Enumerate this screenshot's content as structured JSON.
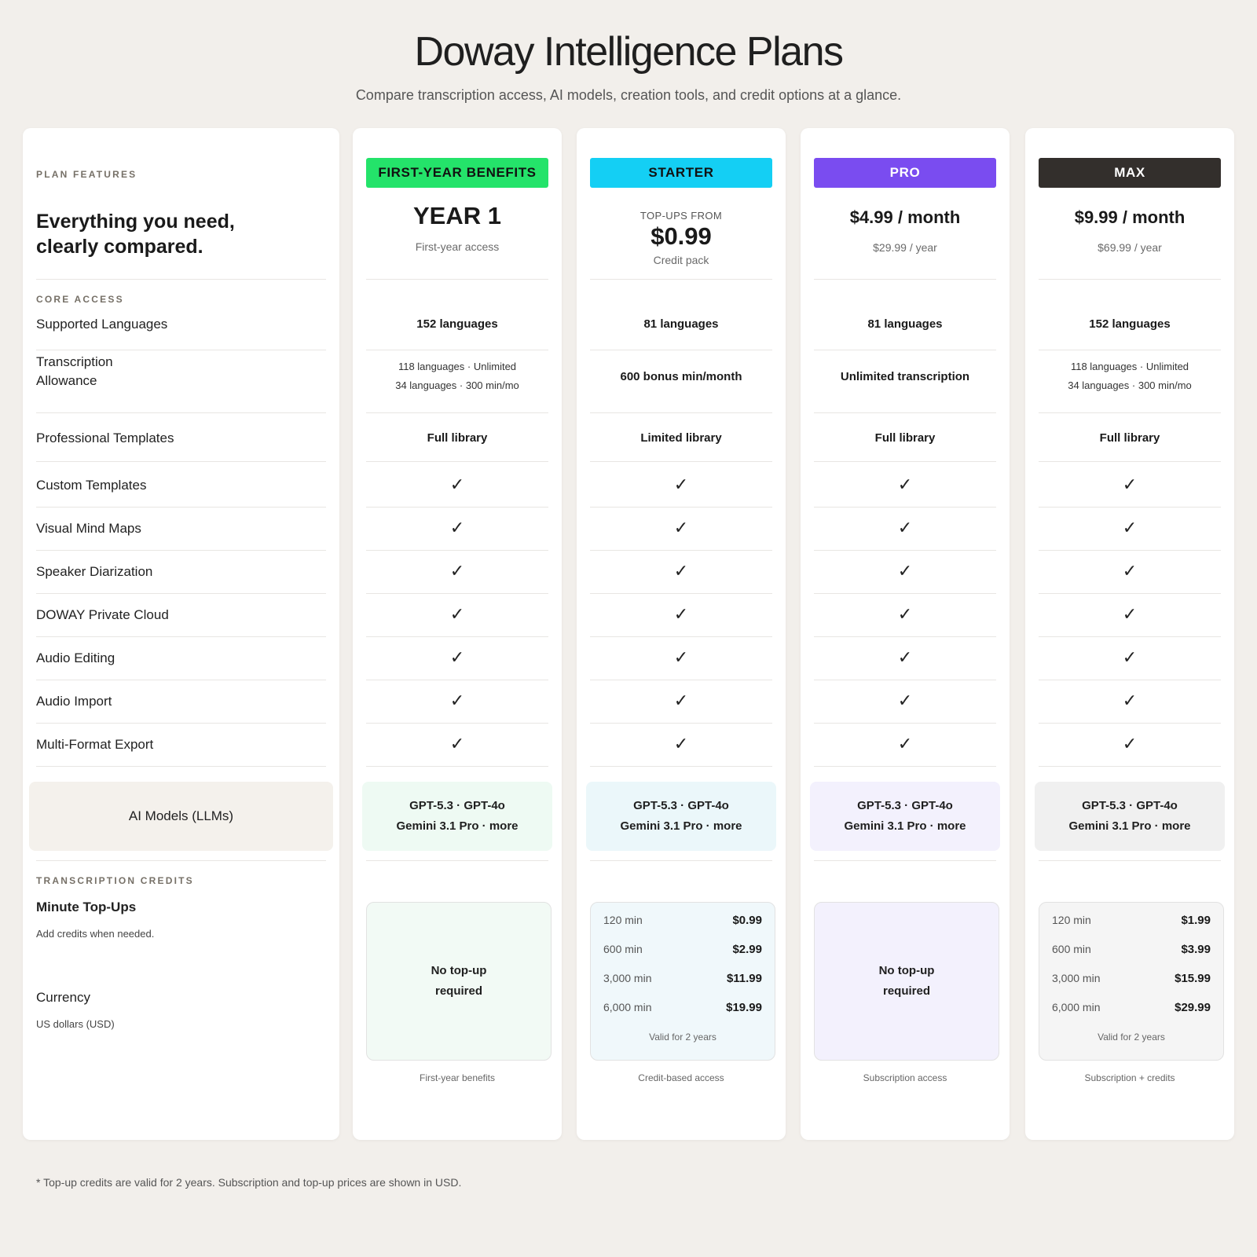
{
  "header": {
    "title": "Doway Intelligence Plans",
    "subtitle": "Compare transcription access, AI models, creation tools, and credit options at a glance."
  },
  "features": {
    "section_plan": "PLAN FEATURES",
    "headline_line1": "Everything you need,",
    "headline_line2": "clearly compared.",
    "section_core": "CORE ACCESS",
    "rows": [
      "Supported Languages",
      "Transcription",
      "Allowance",
      "Professional Templates",
      "Custom Templates",
      "Visual Mind Maps",
      "Speaker Diarization",
      "DOWAY Private Cloud",
      "Audio Editing",
      "Audio Import",
      "Multi-Format Export"
    ],
    "ai_models_label": "AI Models (LLMs)",
    "section_credits": "TRANSCRIPTION CREDITS",
    "topups_label": "Minute Top-Ups",
    "topups_note": "Add credits when needed.",
    "currency_label": "Currency",
    "currency_value": "US dollars (USD)"
  },
  "check_mark": "✓",
  "plans": [
    {
      "badge": "FIRST-YEAR BENEFITS",
      "badge_color": "#24e36a",
      "badge_text_color": "#111111",
      "headline": "YEAR 1",
      "headline_sub": "First-year access",
      "languages": "152 languages",
      "allowance_line1": "118 languages · Unlimited",
      "allowance_line2": "34 languages · 300 min/mo",
      "templates": "Full library",
      "ai_line1": "GPT-5.3 · GPT-4o",
      "ai_line2": "Gemini 3.1 Pro · more",
      "ai_bg": "#eefaf3",
      "credit_bg": "#f2faf5",
      "no_topup_line1": "No top-up",
      "no_topup_line2": "required",
      "footer": "First-year benefits"
    },
    {
      "badge": "STARTER",
      "badge_color": "#14cff4",
      "badge_text_color": "#111111",
      "price_label": "TOP-UPS FROM",
      "price": "$0.99",
      "price_sub": "Credit pack",
      "languages": "81 languages",
      "allowance": "600 bonus min/month",
      "templates": "Limited library",
      "ai_line1": "GPT-5.3 · GPT-4o",
      "ai_line2": "Gemini 3.1 Pro · more",
      "ai_bg": "#ebf7fa",
      "credit_bg": "#f0f8fb",
      "credits": [
        {
          "mins": "120 min",
          "price": "$0.99"
        },
        {
          "mins": "600 min",
          "price": "$2.99"
        },
        {
          "mins": "3,000 min",
          "price": "$11.99"
        },
        {
          "mins": "6,000 min",
          "price": "$19.99"
        }
      ],
      "valid": "Valid for 2 years",
      "footer": "Credit-based access"
    },
    {
      "badge": "PRO",
      "badge_color": "#7a4cf0",
      "badge_text_color": "#ffffff",
      "price": "$4.99 / month",
      "price_sub": "$29.99 / year",
      "languages": "81 languages",
      "allowance": "Unlimited transcription",
      "templates": "Full library",
      "ai_line1": "GPT-5.3 · GPT-4o",
      "ai_line2": "Gemini 3.1 Pro · more",
      "ai_bg": "#f3f1fd",
      "credit_bg": "#f3f1fd",
      "no_topup_line1": "No top-up",
      "no_topup_line2": "required",
      "footer": "Subscription access"
    },
    {
      "badge": "MAX",
      "badge_color": "#332f2c",
      "badge_text_color": "#ffffff",
      "price": "$9.99 / month",
      "price_sub": "$69.99 / year",
      "languages": "152 languages",
      "allowance_line1": "118 languages · Unlimited",
      "allowance_line2": "34 languages · 300 min/mo",
      "templates": "Full library",
      "ai_line1": "GPT-5.3 · GPT-4o",
      "ai_line2": "Gemini 3.1 Pro · more",
      "ai_bg": "#f0f0f0",
      "credit_bg": "#f5f5f5",
      "credits": [
        {
          "mins": "120 min",
          "price": "$1.99"
        },
        {
          "mins": "600 min",
          "price": "$3.99"
        },
        {
          "mins": "3,000 min",
          "price": "$15.99"
        },
        {
          "mins": "6,000 min",
          "price": "$29.99"
        }
      ],
      "valid": "Valid for 2 years",
      "footer": "Subscription + credits"
    }
  ],
  "footnote": "* Top-up credits are valid for 2 years. Subscription and top-up prices are shown in USD."
}
